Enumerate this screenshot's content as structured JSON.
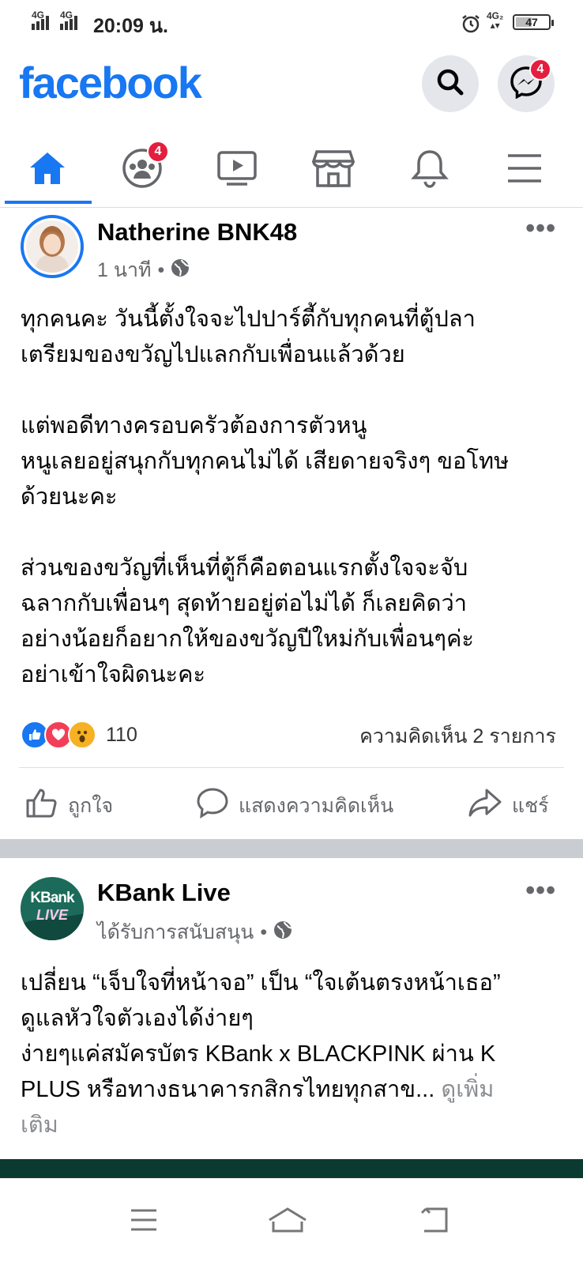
{
  "status_bar": {
    "sim1": "4G",
    "sim2": "4G",
    "time": "20:09 น.",
    "net2": "4G₂",
    "battery": "47"
  },
  "header": {
    "logo": "facebook",
    "messenger_badge": "4"
  },
  "tabs": {
    "groups_badge": "4"
  },
  "post1": {
    "author": "Natherine BNK48",
    "time": "1 นาที",
    "text": {
      "l1": "ทุกคนคะ วันนี้ตั้งใจจะไปปาร์ตี้กับทุกคนที่ตู้ปลา",
      "l2": "เตรียมของขวัญไปแลกกับเพื่อนแล้วด้วย",
      "l3": "แต่พอดีทางครอบครัวต้องการตัวหนู",
      "l4": "หนูเลยอยู่สนุกกับทุกคนไม่ได้ เสียดายจริงๆ ขอโทษ",
      "l5": "ด้วยนะคะ",
      "l6": "ส่วนของขวัญที่เห็นที่ตู้ก็คือตอนแรกตั้งใจจะจับ",
      "l7": "ฉลากกับเพื่อนๆ สุดท้ายอยู่ต่อไม่ได้ ก็เลยคิดว่า",
      "l8": "อย่างน้อยก็อยากให้ของขวัญปีใหม่กับเพื่อนๆค่ะ",
      "l9": "อย่าเข้าใจผิดนะคะ"
    },
    "reaction_count": "110",
    "comments": "ความคิดเห็น 2 รายการ",
    "actions": {
      "like": "ถูกใจ",
      "comment": "แสดงความคิดเห็น",
      "share": "แชร์"
    }
  },
  "post2": {
    "author": "KBank Live",
    "avatar_text_top": "KBank",
    "avatar_text_bottom": "LIVE",
    "sponsored": "ได้รับการสนับสนุน",
    "text": {
      "l1": "เปลี่ยน “เจ็บใจที่หน้าจอ” เป็น “ใจเต้นตรงหน้าเธอ”",
      "l2": "ดูแลหัวใจตัวเองได้ง่ายๆ",
      "l3": "ง่ายๆแค่สมัครบัตร KBank x BLACKPINK ผ่าน K",
      "l4": "PLUS หรือทางธนาคารกสิกรไทยทุกสาข...",
      "see_more_a": "ดูเพิ่ม",
      "see_more_b": "เติม"
    }
  },
  "colors": {
    "brand": "#1877f2",
    "badge": "#e41e3f",
    "kbank": "#1c6b5a"
  }
}
